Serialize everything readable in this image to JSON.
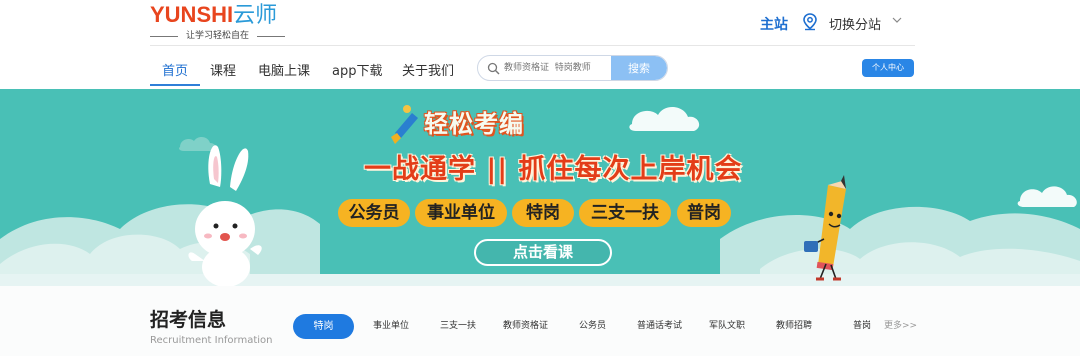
{
  "logo": {
    "word_part1": "YUN",
    "word_part2": "SHI",
    "word_part3": "云师",
    "slogan": "让学习轻松自在"
  },
  "header": {
    "main_site": "主站",
    "switch_site": "切换分站"
  },
  "nav": {
    "items": [
      "首页",
      "课程",
      "电脑上课",
      "app下载",
      "关于我们"
    ],
    "active_index": 0
  },
  "search": {
    "placeholder": "教师资格证  特岗教师",
    "button": "搜索"
  },
  "user_center": "个人中心",
  "banner": {
    "title": "轻松考编",
    "subtitle": "一战通学 || 抓住每次上岸机会",
    "tags": [
      "公务员",
      "事业单位",
      "特岗",
      "三支一扶",
      "普岗"
    ],
    "cta": "点击看课"
  },
  "recruitment": {
    "title": "招考信息",
    "subtitle": "Recruitment Information",
    "tabs": [
      "特岗",
      "事业单位",
      "三支一扶",
      "教师资格证",
      "公务员",
      "普通话考试",
      "军队文职",
      "教师招聘",
      "普岗"
    ],
    "more": "更多>>"
  },
  "colors": {
    "brand_blue": "#1e6fd0",
    "banner_teal": "#49c0b6",
    "tag_yellow": "#f6b322",
    "title_red": "#e33d18"
  }
}
